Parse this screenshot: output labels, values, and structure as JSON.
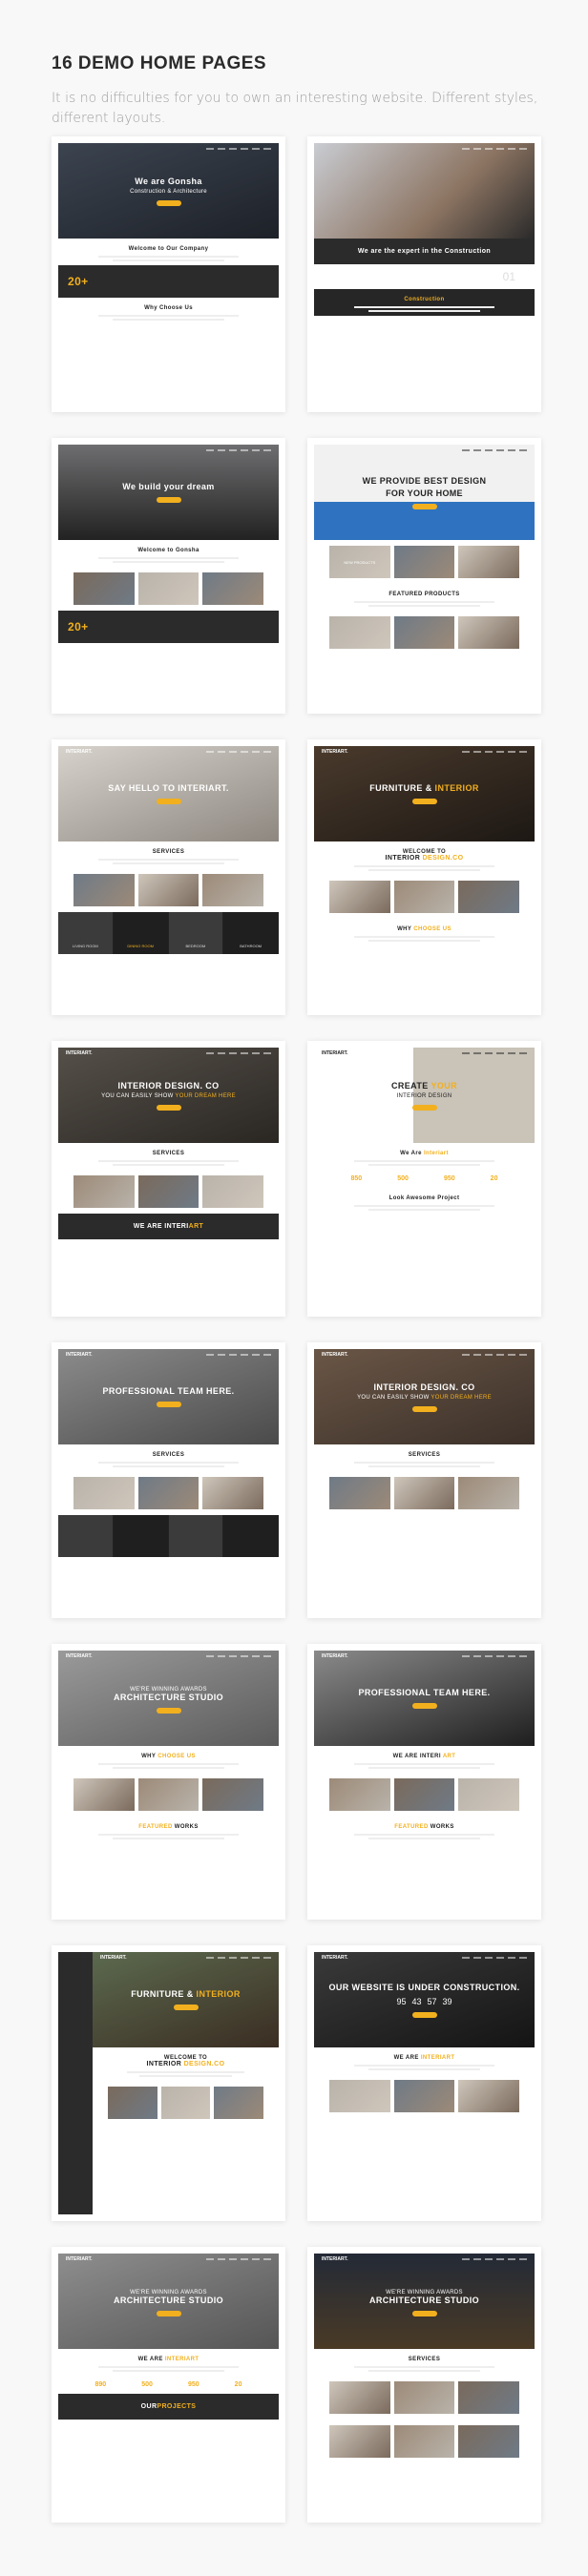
{
  "header": {
    "title": "16 DEMO HOME PAGES",
    "subtitle": "It is no difficulties for you to own an interesting website. Different styles, different layouts."
  },
  "colors": {
    "accent": "#f2b01e",
    "page_bg": "#f8f8f8",
    "dark": "#2b2b2b"
  },
  "demos": [
    {
      "hero_bg": "linear-gradient(160deg,#3c4450,#1d2128)",
      "h1": "We are Gonsha",
      "h2": "Construction & Architecture",
      "sections": [
        {
          "type": "text",
          "title": "Welcome to Our Company"
        },
        {
          "type": "band",
          "title": "20+"
        },
        {
          "type": "text",
          "title": "Why Choose Us"
        }
      ]
    },
    {
      "hero_bg": "linear-gradient(135deg,#c9ccd2,#8c7462 60%,#2a2a2a)",
      "h1": "",
      "h2": "",
      "dark_body": true,
      "sections": [
        {
          "type": "band",
          "title": "We are the expert in the Construction"
        },
        {
          "type": "stats",
          "values": [
            "01"
          ]
        },
        {
          "type": "text",
          "title": "Construction",
          "accent": true
        }
      ]
    },
    {
      "hero_bg": "linear-gradient(180deg,#6e6e70,#222)",
      "h1": "We build your dream",
      "h2": "",
      "sections": [
        {
          "type": "text",
          "title": "Welcome to Gonsha"
        },
        {
          "type": "imgs"
        },
        {
          "type": "band",
          "title": "20+"
        }
      ]
    },
    {
      "hero_bg": "linear-gradient(180deg,#f1f1f1 60%,#2f73c0 60%)",
      "dark_text": true,
      "h1": "WE PROVIDE BEST DESIGN",
      "h2": "FOR YOUR HOME",
      "sections": [
        {
          "type": "imgs",
          "label": "NEW PRODUCTS"
        },
        {
          "type": "text",
          "title": "FEATURED PRODUCTS"
        },
        {
          "type": "imgs"
        }
      ]
    },
    {
      "logo": "INTERIART.",
      "hero_bg": "linear-gradient(160deg,#d7d3cc,#8d8780)",
      "h1": "SAY HELLO TO INTERIART.",
      "h2": "",
      "sections": [
        {
          "type": "text",
          "title": "SERVICES"
        },
        {
          "type": "imgs"
        },
        {
          "type": "rooms",
          "items": [
            "LIVING ROOM",
            "DINING ROOM",
            "BEDROOM",
            "BATHROOM"
          ]
        }
      ]
    },
    {
      "logo": "INTERIART.",
      "hero_bg": "linear-gradient(160deg,#4a3a2c,#1d1814)",
      "h1": "FURNITURE &",
      "h1_accent": "INTERIOR",
      "h2": "",
      "sections": [
        {
          "type": "text",
          "title": "WELCOME TO",
          "title2": "INTERIOR",
          "title2_accent": "DESIGN.CO"
        },
        {
          "type": "imgs"
        },
        {
          "type": "text",
          "title": "WHY",
          "title_accent": "CHOOSE US"
        }
      ]
    },
    {
      "logo": "INTERIART.",
      "hero_bg": "linear-gradient(160deg,#555049,#2a2622)",
      "h1": "INTERIOR DESIGN. CO",
      "h2": "YOU CAN EASILY SHOW",
      "h2_accent": "YOUR DREAM HERE",
      "sections": [
        {
          "type": "text",
          "title": "SERVICES"
        },
        {
          "type": "imgs"
        },
        {
          "type": "band",
          "title": "WE ARE INTERI",
          "title_accent": "ART"
        }
      ]
    },
    {
      "logo": "INTERIART.",
      "hero_bg": "linear-gradient(90deg,#fff 45%,#c9c3b8 45%)",
      "dark_text": true,
      "h1": "CREATE",
      "h1_accent": "YOUR",
      "h2": "INTERIOR DESIGN",
      "sections": [
        {
          "type": "text",
          "title": "We Are",
          "title_accent": "Interiart"
        },
        {
          "type": "stats",
          "values": [
            "850",
            "500",
            "950",
            "20"
          ]
        },
        {
          "type": "text",
          "title": "Look Awesome Project"
        }
      ]
    },
    {
      "logo": "INTERIART.",
      "hero_bg": "linear-gradient(160deg,#8b8b8b,#4a4a4a)",
      "h1": "PROFESSIONAL TEAM HERE.",
      "h2": "",
      "sections": [
        {
          "type": "text",
          "title": "SERVICES"
        },
        {
          "type": "imgs"
        },
        {
          "type": "rooms",
          "items": [
            "",
            "",
            "",
            ""
          ]
        }
      ]
    },
    {
      "logo": "INTERIART.",
      "hero_bg": "linear-gradient(160deg,#6a5646,#3b3029)",
      "h1": "INTERIOR DESIGN. CO",
      "h2": "YOU CAN EASILY SHOW",
      "h2_accent": "YOUR DREAM HERE",
      "sections": [
        {
          "type": "text",
          "title": "SERVICES"
        },
        {
          "type": "imgs"
        }
      ]
    },
    {
      "logo": "INTERIART.",
      "hero_bg": "linear-gradient(160deg,#9a9a9a,#5b5b5b)",
      "h1": "ARCHITECTURE STUDIO",
      "h2": "WE'RE WINNING AWARDS",
      "sections": [
        {
          "type": "text",
          "title": "WHY",
          "title_accent": "CHOOSE US"
        },
        {
          "type": "imgs"
        },
        {
          "type": "text",
          "title": "WORKS",
          "title_accent": "FEATURED"
        }
      ]
    },
    {
      "logo": "INTERIART.",
      "hero_bg": "linear-gradient(160deg,#8a8a8a,#1e1e1e)",
      "h1": "PROFESSIONAL TEAM HERE.",
      "h2": "",
      "sections": [
        {
          "type": "text",
          "title": "WE ARE INTERI",
          "title_accent": "ART"
        },
        {
          "type": "imgs"
        },
        {
          "type": "text",
          "title": "WORKS",
          "title_accent": "FEATURED"
        }
      ]
    },
    {
      "logo": "INTERIART.",
      "hero_bg": "linear-gradient(160deg,#5c6a4f,#3a2d22)",
      "h1": "FURNITURE &",
      "h1_accent": "INTERIOR",
      "h2": "",
      "sidebar": true,
      "sections": [
        {
          "type": "text",
          "title": "WELCOME TO",
          "title2": "INTERIOR",
          "title2_accent": "DESIGN.CO"
        },
        {
          "type": "imgs"
        }
      ]
    },
    {
      "logo": "INTERIART.",
      "hero_bg": "linear-gradient(160deg,#3a3a3a,#141414)",
      "h1": "OUR WEBSITE IS UNDER CONSTRUCTION.",
      "h2": "",
      "countdown": [
        "95",
        "43",
        "57",
        "39"
      ],
      "sections": [
        {
          "type": "text",
          "title": "WE ARE",
          "title_accent": "INTERIART"
        },
        {
          "type": "imgs"
        }
      ]
    },
    {
      "logo": "INTERIART.",
      "hero_bg": "linear-gradient(160deg,#8e8e8e,#555)",
      "h1": "ARCHITECTURE STUDIO",
      "h2": "WE'RE WINNING AWARDS",
      "sections": [
        {
          "type": "text",
          "title": "WE ARE",
          "title_accent": "INTERIART"
        },
        {
          "type": "stats",
          "values": [
            "890",
            "500",
            "950",
            "20"
          ]
        },
        {
          "type": "band",
          "title": "OUR",
          "title_accent": "PROJECTS"
        }
      ]
    },
    {
      "logo": "INTERIART.",
      "hero_bg": "linear-gradient(180deg,#232a36,#4a3a26)",
      "h1": "ARCHITECTURE STUDIO",
      "h2": "WE'RE WINNING AWARDS",
      "sections": [
        {
          "type": "text",
          "title": "SERVICES"
        },
        {
          "type": "imgs"
        },
        {
          "type": "imgs"
        }
      ]
    }
  ]
}
